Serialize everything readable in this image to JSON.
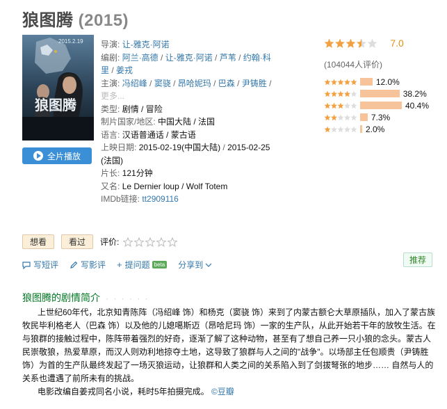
{
  "title": {
    "name": "狼图腾",
    "year": "(2015)"
  },
  "poster": {
    "date_text": "2015.2.19",
    "title_text": "狼图腾"
  },
  "info": {
    "director_label": "导演:",
    "director": "让-雅克·阿诺",
    "writer_label": "编剧:",
    "writers": [
      "阿兰·高德",
      "让-雅克·阿诺",
      "芦苇",
      "约翰·科里",
      "姜戎"
    ],
    "cast_label": "主演:",
    "cast": [
      "冯绍峰",
      "窦骁",
      "昂哈妮玛",
      "巴森",
      "尹铸胜"
    ],
    "more": "更多...",
    "genre_label": "类型:",
    "genre": "剧情 / 冒险",
    "country_label": "制片国家/地区:",
    "country": "中国大陆 / 法国",
    "language_label": "语言:",
    "language": "汉语普通话 / 蒙古语",
    "release_label": "上映日期:",
    "release_1": "2015-02-19(中国大陆)",
    "release_2": "2015-02-25",
    "release_2_region": "(法国)",
    "runtime_label": "片长:",
    "runtime": "121分钟",
    "aka_label": "又名:",
    "aka": "Le Dernier loup / Wolf Totem",
    "imdb_label": "IMDb链接:",
    "imdb": "tt2909116"
  },
  "play_button": "全片播放",
  "rating": {
    "score": "7.0",
    "stars_value": 3.5,
    "votes": "(104044人评价)",
    "distribution": [
      {
        "stars": 5,
        "percent": 12.0,
        "label": "12.0%"
      },
      {
        "stars": 4,
        "percent": 38.2,
        "label": "38.2%"
      },
      {
        "stars": 3,
        "percent": 40.4,
        "label": "40.4%"
      },
      {
        "stars": 2,
        "percent": 7.3,
        "label": "7.3%"
      },
      {
        "stars": 1,
        "percent": 2.0,
        "label": "2.0%"
      }
    ]
  },
  "actions": {
    "want": "想看",
    "seen": "看过",
    "rate_label": "评价:"
  },
  "toolbar": {
    "write_short": "写短评",
    "write_review": "写影评",
    "ask": "提问题",
    "beta": "beta",
    "share": "分享到",
    "recommend": "推荐"
  },
  "summary": {
    "title": "狼图腾的剧情简介",
    "dots": "· · · · · ·",
    "para1": "上世纪60年代，北京知青陈阵（冯绍峰 饰）和杨克（窦骁 饰）来到了内蒙古额仑大草原插队，加入了蒙古族牧民毕利格老人（巴森 饰）以及他的儿媳噶斯迈（昂哈尼玛 饰）一家的生产队，从此开始若干年的放牧生活。在与狼群的接触过程中，陈阵带着强烈的好奇，逐渐了解了这种动物，甚至有了想自己养一只小狼的念头。蒙古人民崇敬狼，热爱草原，而汉人则劝利地掠夺土地，这导致了狼群与人之间的\"战争\"。以场部主任包顺贵（尹铸胜 饰）为首的生产队最终发起了一场灭狼运动，让狼群和人类之间的关系陷入到了剑拔弩张的地步…… 自然与人的关系也遭遇了前所未有的挑战。",
    "para2": "电影改编自姜戎同名小说，耗时5年拍摄完成。",
    "source": "©豆瓣"
  }
}
